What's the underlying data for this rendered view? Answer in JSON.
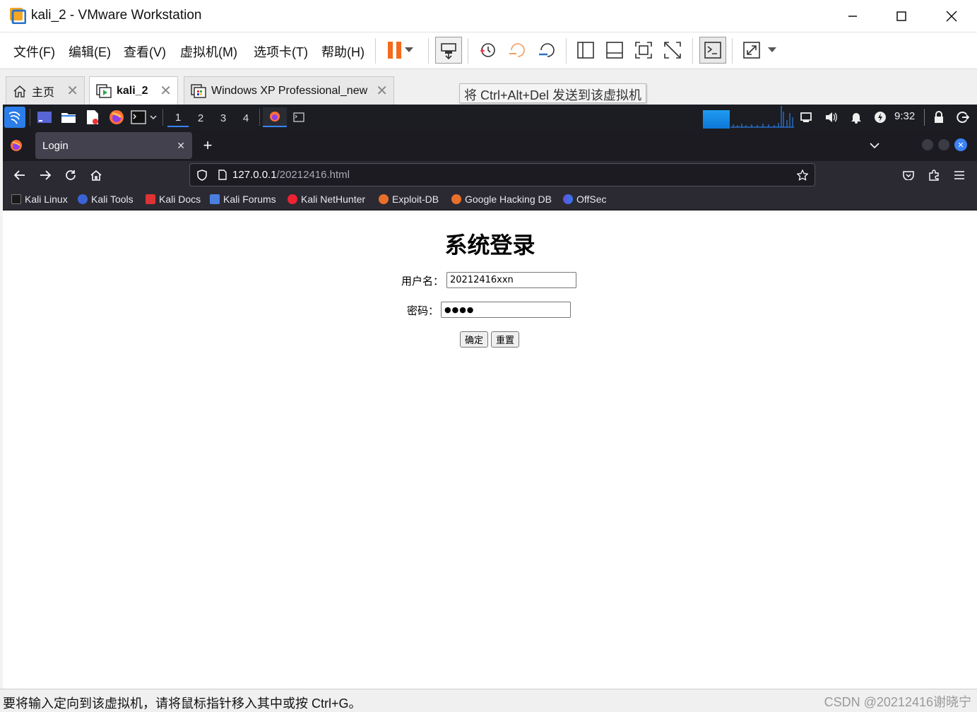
{
  "window": {
    "title": "kali_2 - VMware Workstation"
  },
  "menu": [
    "文件(F)",
    "编辑(E)",
    "查看(V)",
    "虚拟机(M)",
    "选项卡(T)",
    "帮助(H)"
  ],
  "vm_tabs": [
    {
      "label": "主页"
    },
    {
      "label": "kali_2"
    },
    {
      "label": "Windows XP Professional_new"
    }
  ],
  "tooltip": "将 Ctrl+Alt+Del 发送到该虚拟机",
  "kali_panel": {
    "workspaces": [
      "1",
      "2",
      "3",
      "4"
    ],
    "clock": "9:32"
  },
  "firefox": {
    "tab_title": "Login",
    "url_host": "127.0.0.1",
    "url_path": "/20212416.html",
    "bookmarks": [
      "Kali Linux",
      "Kali Tools",
      "Kali Docs",
      "Kali Forums",
      "Kali NetHunter",
      "Exploit-DB",
      "Google Hacking DB",
      "OffSec"
    ]
  },
  "page": {
    "title": "系统登录",
    "username_label": "用户名：",
    "username_value": "20212416xxn",
    "password_label": "密码：",
    "password_value": "●●●●",
    "submit_label": "确定",
    "reset_label": "重置"
  },
  "status": {
    "text": "要将输入定向到该虚拟机，请将鼠标指针移入其中或按 Ctrl+G。",
    "watermark": "CSDN @20212416谢晓宁"
  },
  "colors": {
    "accent_orange": "#f26b1d",
    "kali_blue": "#2b7de9",
    "firefox_dark": "#2b2a33"
  }
}
